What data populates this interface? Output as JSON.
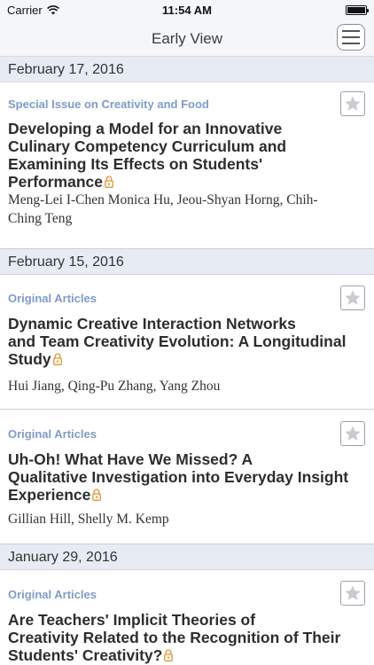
{
  "status_bar": {
    "carrier": "Carrier",
    "time": "11:54 AM"
  },
  "nav": {
    "title": "Early View"
  },
  "colors": {
    "category": "#7f9bc6",
    "lock": "#e8912e",
    "section_bg": "#e7ebf3"
  },
  "sections": [
    {
      "date": "February 17, 2016",
      "articles": [
        {
          "category": "Special Issue on Creativity and Food",
          "title_lines": [
            "Developing a Model for an Innovative",
            "Culinary Competency Curriculum and",
            "Examining Its Effects on Students'",
            "Performance"
          ],
          "author_lines": [
            "Meng-Lei I-Chen Monica Hu, Jeou-Shyan Horng, Chih-",
            "Ching Teng"
          ]
        }
      ]
    },
    {
      "date": "February 15, 2016",
      "articles": [
        {
          "category": "Original Articles",
          "title_lines": [
            "Dynamic Creative Interaction Networks",
            "and Team Creativity Evolution: A Longitudinal",
            "Study"
          ],
          "author_lines": [
            "Hui Jiang, Qing-Pu Zhang, Yang Zhou"
          ]
        },
        {
          "category": "Original Articles",
          "title_lines": [
            "Uh-Oh! What Have We Missed? A",
            "Qualitative Investigation into Everyday Insight",
            "Experience"
          ],
          "author_lines": [
            "Gillian Hill, Shelly M. Kemp"
          ]
        }
      ]
    },
    {
      "date": "January 29, 2016",
      "articles": [
        {
          "category": "Original Articles",
          "title_lines": [
            "Are Teachers' Implicit Theories of",
            "Creativity Related to the Recognition of Their",
            "Students' Creativity?"
          ],
          "author_lines": []
        }
      ]
    }
  ]
}
